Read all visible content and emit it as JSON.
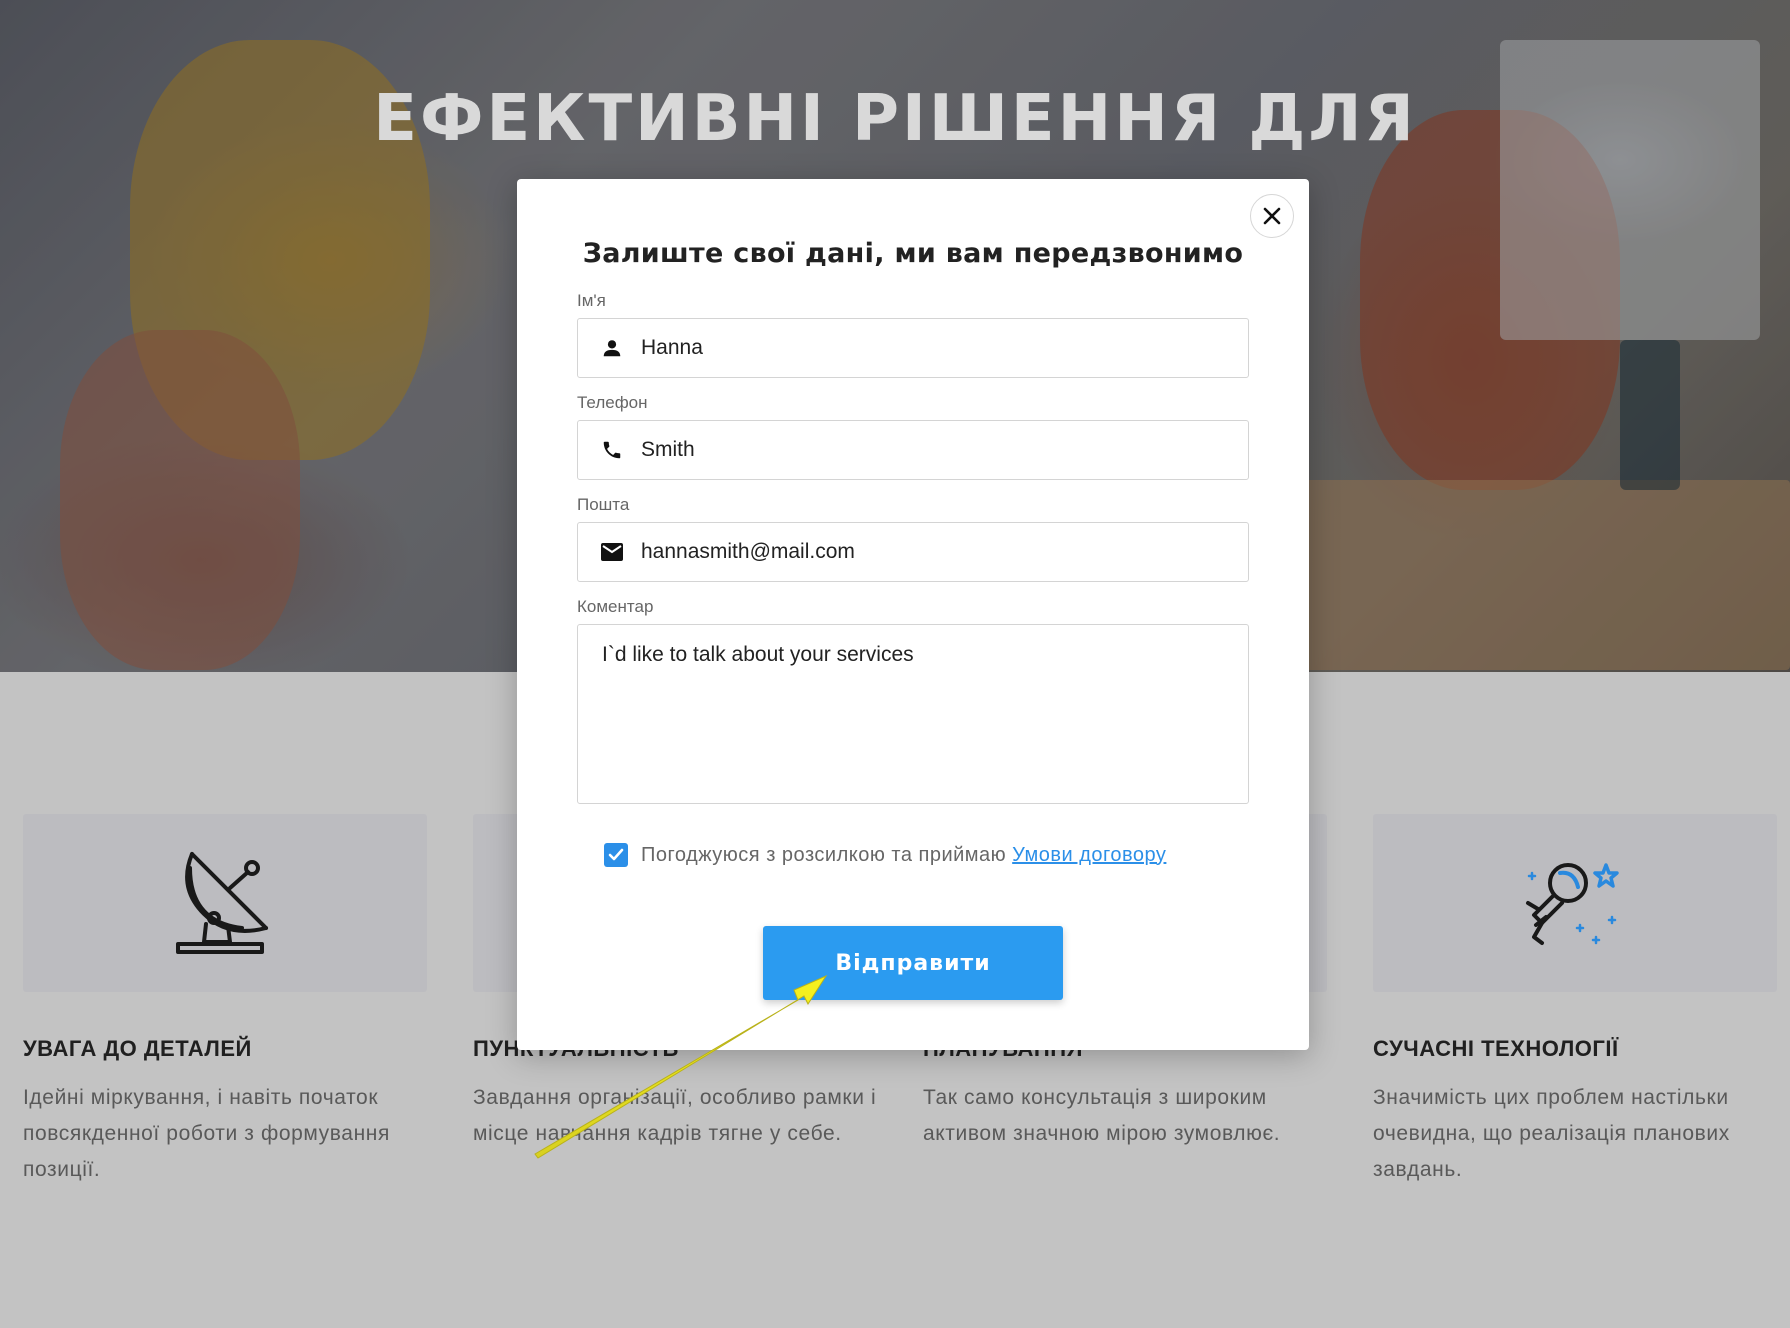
{
  "hero": {
    "title": "ЕФЕКТИВНІ РІШЕННЯ ДЛЯ"
  },
  "features": [
    {
      "icon": "satellite-dish-icon",
      "title": "УВАГА ДО ДЕТАЛЕЙ",
      "text": "Ідейні міркування, і навіть початок повсякденної роботи з формування позиції."
    },
    {
      "icon": "",
      "title": "ПУНКТУАЛЬНІСТЬ",
      "text": "Завдання організації, особливо рамки і місце навчання кадрів тягне у себе."
    },
    {
      "icon": "",
      "title": "ПЛАНУВАННЯ",
      "text": "Так само консультація з широким активом значною мірою зумовлює."
    },
    {
      "icon": "astronaut-icon",
      "title": "СУЧАСНІ ТЕХНОЛОГІЇ",
      "text": "Значимість цих проблем настільки очевидна, що реалізація планових завдань."
    }
  ],
  "modal": {
    "title": "Залиште свої дані, ми вам передзвонимо",
    "name_label": "Ім'я",
    "name_value": "Hanna",
    "phone_label": "Телефон",
    "phone_value": "Smith",
    "email_label": "Пошта",
    "email_value": "hannasmith@mail.com",
    "comment_label": "Коментар",
    "comment_value": "I`d like to talk about your services",
    "consent_text": "Погоджуюся з розсилкою та приймаю",
    "consent_link": "Умови договору",
    "consent_checked": true,
    "submit_label": "Відправити"
  },
  "colors": {
    "accent": "#2b9bf0",
    "annotation_arrow": "#f2ee1a"
  }
}
